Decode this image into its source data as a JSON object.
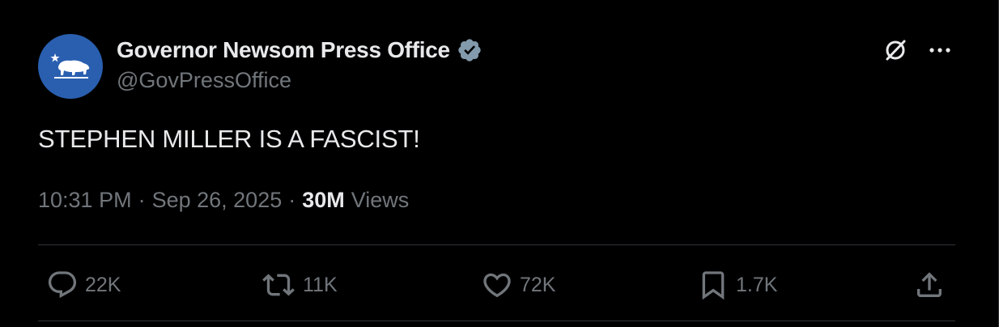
{
  "author": {
    "display_name": "Governor Newsom Press Office",
    "handle": "@GovPressOffice",
    "verified": true,
    "avatar_icon": "california-bear-icon",
    "avatar_color": "#2a5fb0",
    "verified_color": "#829aab"
  },
  "tweet": {
    "text": "STEPHEN MILLER IS A FASCIST!"
  },
  "meta": {
    "time": "10:31 PM",
    "separator": "·",
    "date": "Sep 26, 2025",
    "views_count": "30M",
    "views_label": "Views"
  },
  "actions": {
    "replies": "22K",
    "reposts": "11K",
    "likes": "72K",
    "bookmarks": "1.7K"
  },
  "colors": {
    "background": "#000000",
    "text_primary": "#e7e9ea",
    "text_secondary": "#71767b",
    "border": "#2f3336"
  }
}
